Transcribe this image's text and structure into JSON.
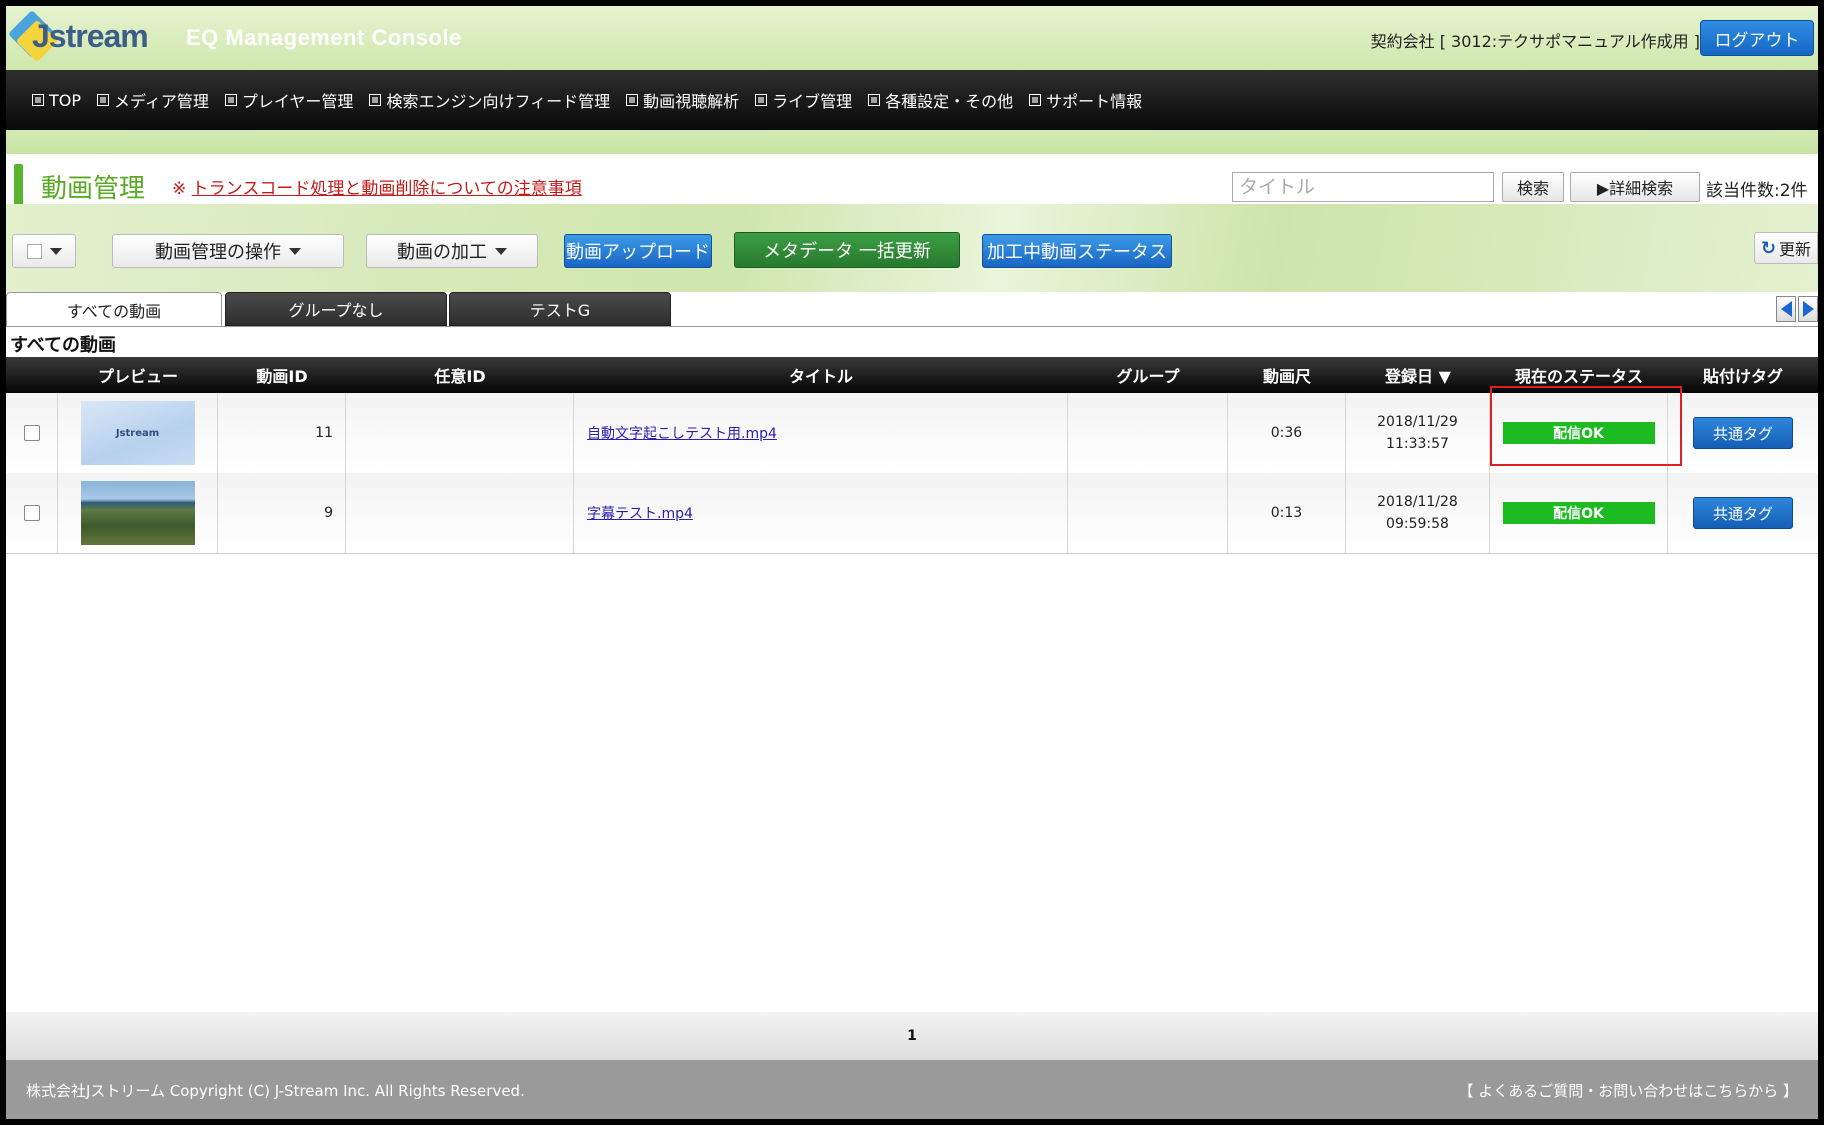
{
  "header": {
    "logo_text": "Jstream",
    "console_title": "EQ Management Console",
    "contract_text": "契約会社 [ 3012:テクサポマニュアル作成用 ]",
    "logout_label": "ログアウト"
  },
  "nav": {
    "items": [
      {
        "label": "TOP"
      },
      {
        "label": "メディア管理"
      },
      {
        "label": "プレイヤー管理"
      },
      {
        "label": "検索エンジン向けフィード管理"
      },
      {
        "label": "動画視聴解析"
      },
      {
        "label": "ライブ管理"
      },
      {
        "label": "各種設定・その他"
      },
      {
        "label": "サポート情報"
      }
    ]
  },
  "page": {
    "title": "動画管理",
    "notice_prefix": "※",
    "notice_link": "トランスコード処理と動画削除についての注意事項",
    "search_placeholder": "タイトル",
    "search_label": "検索",
    "advanced_search_label": "▶詳細検索",
    "count_text": "該当件数:2件"
  },
  "toolbar": {
    "ops_label": "動画管理の操作",
    "processing_label": "動画の加工",
    "upload_label": "動画アップロード",
    "metadata_label": "メタデータ 一括更新",
    "status_label": "加工中動画ステータス",
    "refresh_label": "更新"
  },
  "tabs": [
    {
      "label": "すべての動画"
    },
    {
      "label": "グループなし"
    },
    {
      "label": "テストG"
    }
  ],
  "section_title": "すべての動画",
  "table": {
    "columns": [
      "プレビュー",
      "動画ID",
      "任意ID",
      "タイトル",
      "グループ",
      "動画尺",
      "登録日 ▼",
      "現在のステータス",
      "貼付けタグ"
    ],
    "rows": [
      {
        "id": "11",
        "any_id": "",
        "title": "自動文字起こしテスト用.mp4",
        "group": "",
        "duration": "0:36",
        "date": "2018/11/29",
        "time": "11:33:57",
        "status": "配信OK",
        "tag": "共通タグ",
        "thumb_text": "Jstream"
      },
      {
        "id": "9",
        "any_id": "",
        "title": "字幕テスト.mp4",
        "group": "",
        "duration": "0:13",
        "date": "2018/11/28",
        "time": "09:59:58",
        "status": "配信OK",
        "tag": "共通タグ"
      }
    ]
  },
  "pager": {
    "current": "1"
  },
  "footer": {
    "copyright": "株式会社Jストリーム Copyright (C) J-Stream Inc. All Rights Reserved.",
    "faq": "【 よくあるご質問・お問い合わせはこちらから 】"
  },
  "colors": {
    "header_green": "#cfe7ae",
    "title_green": "#5aaa24",
    "status_ok": "#1dbb22",
    "button_blue": "#1866c4",
    "button_green": "#267a2d",
    "notice_red": "#c41a1a",
    "highlight_red": "#e02020"
  },
  "icons": [
    "logo-icon",
    "nav-check-icon",
    "caret-down-icon",
    "refresh-icon",
    "arrow-left-icon",
    "arrow-right-icon",
    "checkbox-icon"
  ]
}
